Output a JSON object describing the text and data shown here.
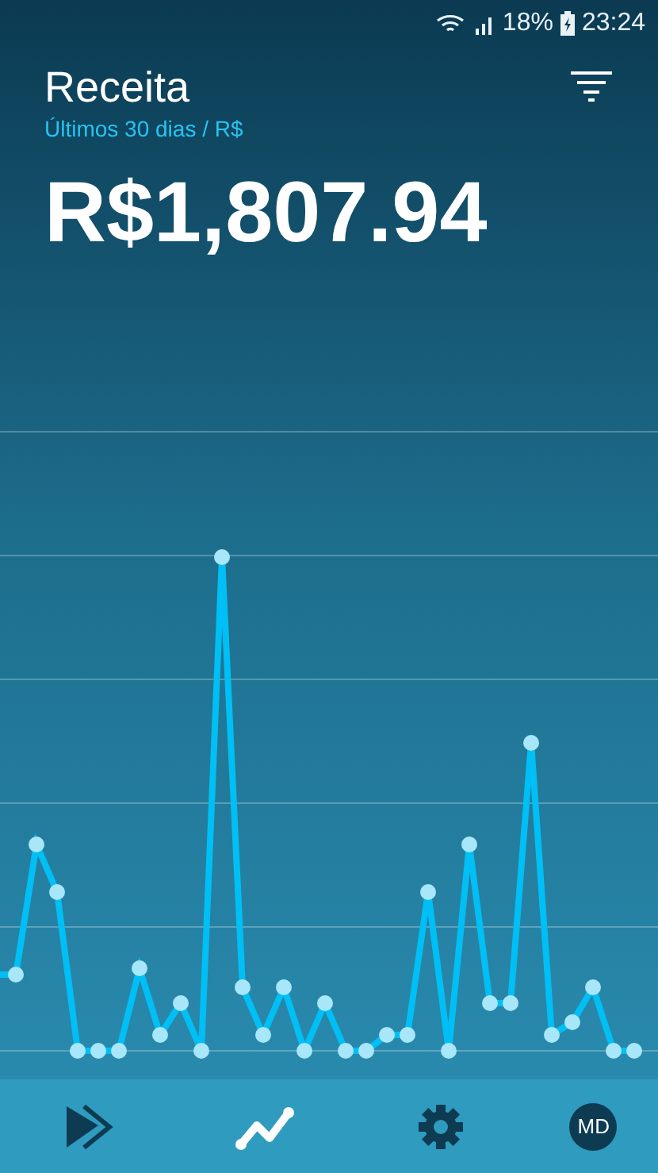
{
  "status_bar": {
    "battery": "18%",
    "time": "23:24"
  },
  "header": {
    "title": "Receita",
    "subtitle": "Últimos 30 dias / R$",
    "total": "R$1,807.94"
  },
  "nav": [
    {
      "kind": "forward",
      "selected": false
    },
    {
      "kind": "chart",
      "selected": true
    },
    {
      "kind": "settings",
      "selected": false
    },
    {
      "kind": "avatar",
      "label": "MD",
      "selected": false
    }
  ]
}
